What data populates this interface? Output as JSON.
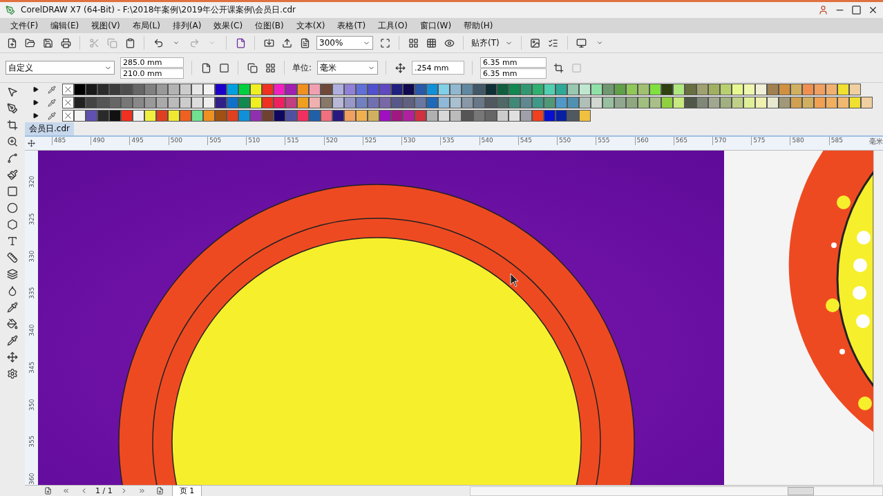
{
  "window": {
    "title": "CorelDRAW X7 (64-Bit) - F:\\2018年案例\\2019年公开课案例\\会员日.cdr"
  },
  "menu": [
    "文件(F)",
    "编辑(E)",
    "视图(V)",
    "布局(L)",
    "排列(A)",
    "效果(C)",
    "位图(B)",
    "文本(X)",
    "表格(T)",
    "工具(O)",
    "窗口(W)",
    "帮助(H)"
  ],
  "toolbar": {
    "zoom": "300%",
    "snap": "贴齐(T)"
  },
  "property_bar": {
    "page_size": "自定义",
    "width": "285.0 mm",
    "height": "210.0 mm",
    "unit_label": "单位:",
    "unit": "毫米",
    "nudge": ".254 mm",
    "dup_x": "6.35 mm",
    "dup_y": "6.35 mm"
  },
  "palettes": [
    {
      "swatches": [
        {
          "color": "#000000"
        },
        {
          "color": "#1a1a1a"
        },
        {
          "color": "#2b2b2b"
        },
        {
          "color": "#3c3c3c"
        },
        {
          "color": "#4d4d4d"
        },
        {
          "color": "#666666"
        },
        {
          "color": "#808080"
        },
        {
          "color": "#999999"
        },
        {
          "color": "#b3b3b3"
        },
        {
          "color": "#cccccc"
        },
        {
          "color": "#e6e6e6"
        },
        {
          "color": "#f2f2f2"
        },
        {
          "color": "#1a00c8"
        },
        {
          "color": "#00a0e0"
        },
        {
          "color": "#00d040"
        },
        {
          "color": "#f0f020"
        },
        {
          "color": "#f03020"
        },
        {
          "color": "#f020c0"
        },
        {
          "color": "#a020b0"
        },
        {
          "color": "#f09020"
        },
        {
          "color": "#f0a0b0"
        },
        {
          "color": "#704838"
        },
        {
          "color": "#b0b0e0"
        },
        {
          "color": "#9080d8"
        },
        {
          "color": "#6070d8"
        },
        {
          "color": "#5050d0"
        },
        {
          "color": "#6048c0"
        },
        {
          "color": "#202080"
        },
        {
          "color": "#100850"
        },
        {
          "color": "#2858a8"
        },
        {
          "color": "#1090d8"
        },
        {
          "color": "#80d0e8"
        },
        {
          "color": "#90b8d0"
        },
        {
          "color": "#6088a0"
        },
        {
          "color": "#405868"
        },
        {
          "color": "#103038"
        },
        {
          "color": "#106040"
        },
        {
          "color": "#108850"
        },
        {
          "color": "#309870"
        },
        {
          "color": "#30b070"
        },
        {
          "color": "#50d0b0"
        },
        {
          "color": "#30a898"
        },
        {
          "color": "#98c8b0"
        },
        {
          "color": "#c0e8d0"
        },
        {
          "color": "#90e0a8"
        },
        {
          "color": "#709870"
        },
        {
          "color": "#60a048"
        },
        {
          "color": "#90c858"
        },
        {
          "color": "#a0c070"
        },
        {
          "color": "#80e040"
        },
        {
          "color": "#304010"
        },
        {
          "color": "#b0e880"
        },
        {
          "color": "#687040"
        },
        {
          "color": "#a0a070"
        },
        {
          "color": "#a0b060"
        },
        {
          "color": "#b8d070"
        },
        {
          "color": "#e8f890"
        },
        {
          "color": "#f0f8b0"
        },
        {
          "color": "#f0f0d8"
        },
        {
          "color": "#a08050"
        },
        {
          "color": "#d09040"
        },
        {
          "color": "#d0b060"
        },
        {
          "color": "#f09050"
        },
        {
          "color": "#f0a060"
        },
        {
          "color": "#f0b070"
        },
        {
          "color": "#f0e030"
        },
        {
          "color": "#f0d0a0"
        }
      ]
    },
    {
      "swatches": [
        {
          "color": "#222222"
        },
        {
          "color": "#444444"
        },
        {
          "color": "#555555"
        },
        {
          "color": "#666666"
        },
        {
          "color": "#777777"
        },
        {
          "color": "#888888"
        },
        {
          "color": "#999999"
        },
        {
          "color": "#aaaaaa"
        },
        {
          "color": "#bbbbbb"
        },
        {
          "color": "#cccccc"
        },
        {
          "color": "#dddddd"
        },
        {
          "color": "#eeeeee"
        },
        {
          "color": "#302088"
        },
        {
          "color": "#1070c8"
        },
        {
          "color": "#108850"
        },
        {
          "color": "#f0f020"
        },
        {
          "color": "#f03020"
        },
        {
          "color": "#f02060"
        },
        {
          "color": "#c04080"
        },
        {
          "color": "#f0a020"
        },
        {
          "color": "#f0b0b0"
        },
        {
          "color": "#887868"
        },
        {
          "color": "#b8b8d8"
        },
        {
          "color": "#9898c8"
        },
        {
          "color": "#7080c0"
        },
        {
          "color": "#7070b0"
        },
        {
          "color": "#7868a8"
        },
        {
          "color": "#585888"
        },
        {
          "color": "#606080"
        },
        {
          "color": "#6878a0"
        },
        {
          "color": "#2068b8"
        },
        {
          "color": "#90b8d8"
        },
        {
          "color": "#a8c0d0"
        },
        {
          "color": "#8898a8"
        },
        {
          "color": "#687888"
        },
        {
          "color": "#505860"
        },
        {
          "color": "#506868"
        },
        {
          "color": "#408878"
        },
        {
          "color": "#608890"
        },
        {
          "color": "#409888"
        },
        {
          "color": "#509878"
        },
        {
          "color": "#5098c8"
        },
        {
          "color": "#5090b0"
        },
        {
          "color": "#b0c0b8"
        },
        {
          "color": "#d0d8d0"
        },
        {
          "color": "#98c0a0"
        },
        {
          "color": "#90a890"
        },
        {
          "color": "#90a880"
        },
        {
          "color": "#a0c080"
        },
        {
          "color": "#a8c088"
        },
        {
          "color": "#90d040"
        },
        {
          "color": "#c8e880"
        },
        {
          "color": "#505848"
        },
        {
          "color": "#808878"
        },
        {
          "color": "#a0a890"
        },
        {
          "color": "#a0b080"
        },
        {
          "color": "#c0d088"
        },
        {
          "color": "#e0f098"
        },
        {
          "color": "#f0f0b0"
        },
        {
          "color": "#e8e8d0"
        },
        {
          "color": "#a09878"
        },
        {
          "color": "#d0a050"
        },
        {
          "color": "#d0b060"
        },
        {
          "color": "#f0a050"
        },
        {
          "color": "#f0b060"
        },
        {
          "color": "#f0b870"
        },
        {
          "color": "#f0e030"
        },
        {
          "color": "#f0d0a0"
        }
      ]
    },
    {
      "swatches": [
        {
          "color": "#f2f2f2"
        },
        {
          "color": "#6050b0"
        },
        {
          "color": "#2a2a2a"
        },
        {
          "color": "#111111"
        },
        {
          "color": "#f03020"
        },
        {
          "color": "#f0f0f0"
        },
        {
          "color": "#f0f040"
        },
        {
          "color": "#e04020"
        },
        {
          "color": "#f0e830"
        },
        {
          "color": "#f06020"
        },
        {
          "color": "#70e090"
        },
        {
          "color": "#f09020"
        },
        {
          "color": "#a05010"
        },
        {
          "color": "#e04020"
        },
        {
          "color": "#1090d8"
        },
        {
          "color": "#9030b0"
        },
        {
          "color": "#704030"
        },
        {
          "color": "#100860"
        },
        {
          "color": "#5050a0"
        },
        {
          "color": "#f03060"
        },
        {
          "color": "#2060a8"
        },
        {
          "color": "#f07080"
        },
        {
          "color": "#281880"
        },
        {
          "color": "#f0a060"
        },
        {
          "color": "#f0b050"
        },
        {
          "color": "#d0b060"
        },
        {
          "color": "#a010c0"
        },
        {
          "color": "#a01880"
        },
        {
          "color": "#b020a0"
        },
        {
          "color": "#d03040"
        },
        {
          "color": "#b0b0b0"
        },
        {
          "color": "#d8d8d8"
        },
        {
          "color": "#bbbbbb"
        },
        {
          "color": "#555555"
        },
        {
          "color": "#777777"
        },
        {
          "color": "#666666"
        },
        {
          "color": "#cccccc"
        },
        {
          "color": "#e0e0e0"
        },
        {
          "color": "#a0a0a8"
        },
        {
          "color": "#f04020"
        },
        {
          "color": "#0810d0"
        },
        {
          "color": "#0820a0"
        },
        {
          "color": "#505860"
        },
        {
          "color": "#f0c040"
        }
      ]
    }
  ],
  "document_tab": "会员日.cdr",
  "h_ruler": [
    "485",
    "490",
    "495",
    "500",
    "505",
    "510",
    "515",
    "520",
    "525",
    "530",
    "535",
    "540",
    "545",
    "550",
    "555",
    "560",
    "565",
    "570",
    "575",
    "580",
    "585"
  ],
  "h_ruler_unit": "毫米",
  "v_ruler": [
    "320",
    "325",
    "330",
    "335",
    "340",
    "345",
    "350",
    "355",
    "360"
  ],
  "page_nav": {
    "count": "1 / 1",
    "tab": "页 1"
  }
}
